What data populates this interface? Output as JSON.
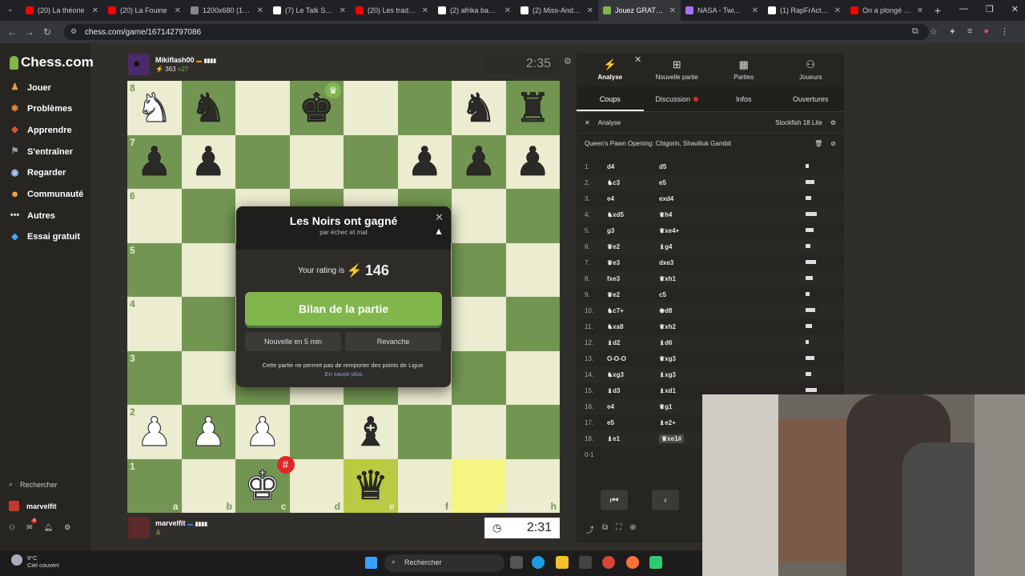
{
  "browser": {
    "tabs": [
      {
        "label": "(20) La théorie",
        "color": "#ff0000"
      },
      {
        "label": "(20) La Fouine",
        "color": "#ff0000"
      },
      {
        "label": "1200x680 (120...",
        "color": "#888888"
      },
      {
        "label": "(7) Le Talk So ...",
        "color": "#ffffff"
      },
      {
        "label": "(20) Les traduc...",
        "color": "#ff0000"
      },
      {
        "label": "(2) afrika bamb...",
        "color": "#ffffff"
      },
      {
        "label": "(2) Miss-Andre...",
        "color": "#ffffff"
      },
      {
        "label": "Jouez GRATUIT...",
        "color": "#81b64c",
        "active": true
      },
      {
        "label": "NASA - Twi...",
        "color": "#a970ff"
      },
      {
        "label": "(1) RapFrActua...",
        "color": "#ffffff"
      },
      {
        "label": "On a plongé d...",
        "color": "#ff0000"
      }
    ],
    "url": "chess.com/game/167142797086"
  },
  "sidebar": {
    "logo": "Chess.com",
    "items": [
      {
        "label": "Jouer",
        "icon": "play-icon",
        "color": "#e2a04c"
      },
      {
        "label": "Problèmes",
        "icon": "puzzle-icon",
        "color": "#e58c3b"
      },
      {
        "label": "Apprendre",
        "icon": "learn-icon",
        "color": "#e04f3b"
      },
      {
        "label": "S'entraîner",
        "icon": "train-icon",
        "color": "#9aa0a6"
      },
      {
        "label": "Regarder",
        "icon": "watch-icon",
        "color": "#a8c7fa"
      },
      {
        "label": "Communauté",
        "icon": "community-icon",
        "color": "#f2b74a"
      },
      {
        "label": "Autres",
        "icon": "more-icon",
        "color": "#dddddd"
      },
      {
        "label": "Essai gratuit",
        "icon": "diamond-icon",
        "color": "#3fa9f5"
      }
    ],
    "search_label": "Rechercher",
    "user_label": "marvelfit",
    "mail_badge": "4"
  },
  "top_player": {
    "name": "Mikiflash00",
    "rating": "363",
    "delta": "+27",
    "clock": "2:35"
  },
  "bottom_player": {
    "name": "marvelfit",
    "clock": "2:31"
  },
  "board": {
    "ranks": [
      "8",
      "7",
      "6",
      "5",
      "4",
      "3",
      "2",
      "1"
    ],
    "files": [
      "a",
      "b",
      "c",
      "d",
      "e",
      "f",
      "g",
      "h"
    ],
    "pieces": [
      [
        "wN",
        "bN",
        "",
        "bK",
        "",
        "",
        "bN",
        "bR"
      ],
      [
        "bP",
        "bP",
        "",
        "",
        "",
        "bP",
        "bP",
        "bP"
      ],
      [
        "",
        "",
        "",
        "",
        "",
        "",
        "",
        ""
      ],
      [
        "",
        "",
        "",
        "",
        "",
        "",
        "",
        ""
      ],
      [
        "",
        "",
        "",
        "",
        "",
        "",
        "",
        ""
      ],
      [
        "",
        "",
        "",
        "",
        "",
        "",
        "",
        ""
      ],
      [
        "wP",
        "wP",
        "wP",
        "",
        "bB",
        "",
        "",
        ""
      ],
      [
        "",
        "",
        "wK",
        "",
        "bQ",
        "",
        "",
        ""
      ]
    ],
    "highlights": [
      [
        7,
        4,
        "hl"
      ],
      [
        7,
        6,
        "hl2"
      ]
    ]
  },
  "modal": {
    "title": "Les Noirs ont gagné",
    "subtitle": "par échec et mat",
    "rating_label": "Your rating is",
    "rating_value": "146",
    "primary_button": "Bilan de la partie",
    "rematch_5min": "Nouvelle en 5 min",
    "rematch": "Revanche",
    "note": "Cette partie ne permet pas de remporter des points de Ligue.",
    "note_link": "En savoir plus"
  },
  "panel": {
    "tabs": [
      {
        "label": "Analyse",
        "icon": "analysis-icon"
      },
      {
        "label": "Nouvelle partie",
        "icon": "plus-icon"
      },
      {
        "label": "Parties",
        "icon": "board-icon"
      },
      {
        "label": "Joueurs",
        "icon": "players-icon"
      }
    ],
    "subtabs": [
      "Coups",
      "Discussion",
      "Infos",
      "Ouvertures"
    ],
    "analysis_label": "Analyse",
    "engine_label": "Stockfish 18 Lite",
    "opening": "Queen's Pawn Opening: Chigorin, Shaviliuk Gambit",
    "moves": [
      {
        "n": "1.",
        "w": "d4",
        "b": "d5"
      },
      {
        "n": "2.",
        "w": "♞c3",
        "b": "e5"
      },
      {
        "n": "3.",
        "w": "e4",
        "b": "exd4"
      },
      {
        "n": "4.",
        "w": "♞xd5",
        "b": "♛h4"
      },
      {
        "n": "5.",
        "w": "g3",
        "b": "♛xe4+"
      },
      {
        "n": "6.",
        "w": "♛e2",
        "b": "♝g4"
      },
      {
        "n": "7.",
        "w": "♛e3",
        "b": "dxe3"
      },
      {
        "n": "8.",
        "w": "fxe3",
        "b": "♛xh1"
      },
      {
        "n": "9.",
        "w": "♛e2",
        "b": "c5"
      },
      {
        "n": "10.",
        "w": "♞c7+",
        "b": "♚d8"
      },
      {
        "n": "11.",
        "w": "♞xa8",
        "b": "♛xh2"
      },
      {
        "n": "12.",
        "w": "♝d2",
        "b": "♝d6"
      },
      {
        "n": "13.",
        "w": "O-O-O",
        "b": "♛xg3"
      },
      {
        "n": "14.",
        "w": "♞xg3",
        "b": "♝xg3"
      },
      {
        "n": "15.",
        "w": "♝d3",
        "b": "♝xd1"
      },
      {
        "n": "16.",
        "w": "e4",
        "b": "♛g1"
      },
      {
        "n": "17.",
        "w": "e5",
        "b": "♝e2+"
      },
      {
        "n": "18.",
        "w": "♝e1",
        "b": "♛xe1#"
      }
    ],
    "result": "0-1"
  },
  "taskbar": {
    "temp": "9°C",
    "weather": "Ciel couvert",
    "search": "Rechercher"
  }
}
